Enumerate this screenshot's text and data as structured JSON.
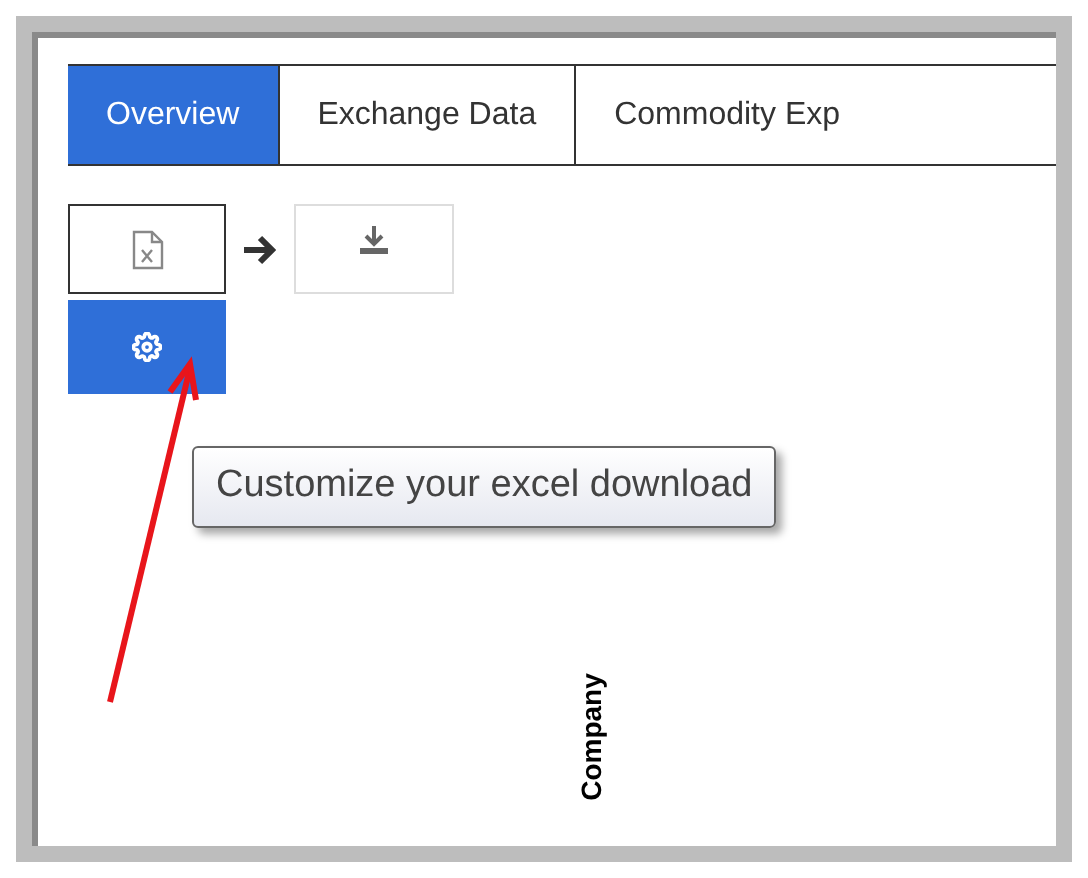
{
  "tabs": [
    {
      "label": "Overview",
      "selected": true
    },
    {
      "label": "Exchange Data",
      "selected": false
    },
    {
      "label": "Commodity Exp",
      "selected": false
    }
  ],
  "tooltip": "Customize your excel download",
  "column_header": "Company"
}
